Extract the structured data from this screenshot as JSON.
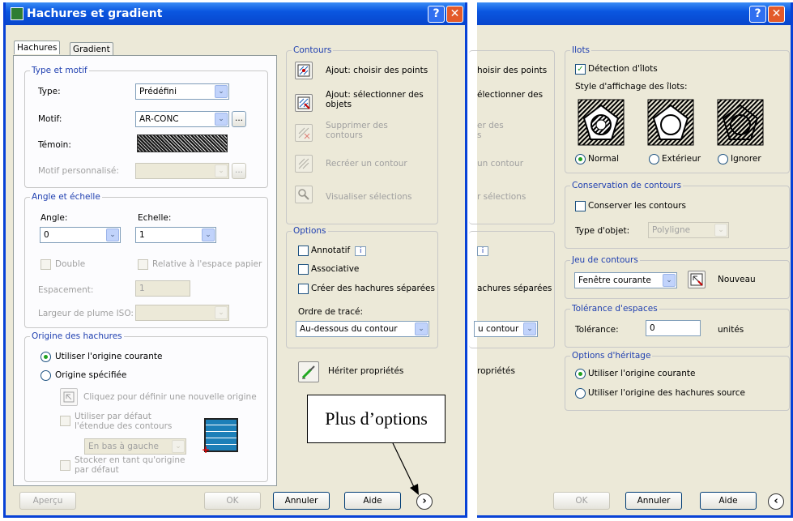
{
  "window_title": "Hachures et gradient",
  "tabs": {
    "hachures": "Hachures",
    "gradient": "Gradient"
  },
  "type_motif": {
    "title": "Type et motif",
    "type_label": "Type:",
    "type_value": "Prédéfini",
    "motif_label": "Motif:",
    "motif_value": "AR-CONC",
    "browse": "...",
    "temoin_label": "Témoin:",
    "motif_perso_label": "Motif personnalisé:"
  },
  "angle": {
    "title": "Angle et échelle",
    "angle_label": "Angle:",
    "angle_value": "0",
    "echelle_label": "Echelle:",
    "echelle_value": "1",
    "double": "Double",
    "relative": "Relative à l'espace papier",
    "espacement_label": "Espacement:",
    "espacement_value": "1",
    "largeur_label": "Largeur de plume ISO:"
  },
  "origine": {
    "title": "Origine des hachures",
    "courante": "Utiliser l'origine courante",
    "specifiee": "Origine spécifiée",
    "cliquez": "Cliquez pour définir une nouvelle origine",
    "defaut_etendue": "Utiliser par défaut l'étendue des contours",
    "position": "En bas à gauche",
    "stocker": "Stocker en tant qu'origine par défaut"
  },
  "contours": {
    "title": "Contours",
    "ajout_points": "Ajout: choisir des points",
    "ajout_objets": "Ajout: sélectionner des objets",
    "supprimer": "Supprimer des contours",
    "recreer": "Recréer un contour",
    "visualiser": "Visualiser sélections"
  },
  "options": {
    "title": "Options",
    "annotatif": "Annotatif",
    "associative": "Associative",
    "separees": "Créer des hachures séparées",
    "ordre_label": "Ordre de tracé:",
    "ordre_value": "Au-dessous du contour",
    "info": "i"
  },
  "heriter": "Hériter propriétés",
  "callout": "Plus d’options",
  "bottom": {
    "apercu": "Aperçu",
    "ok": "OK",
    "annuler": "Annuler",
    "aide": "Aide",
    "more": "›",
    "less": "‹"
  },
  "partial": {
    "points": "hoisir des points",
    "objets": "électionner des",
    "supp": "er des",
    "supp2": "s",
    "recreer": "un contour",
    "visu": "r sélections",
    "info": "i",
    "separees": "achures séparées",
    "ordre": "u contour",
    "heriter": "ropriétés"
  },
  "ilots": {
    "title": "Ilots",
    "detection": "Détection d'îlots",
    "style_label": "Style d'affichage des îlots:",
    "normal": "Normal",
    "exterieur": "Extérieur",
    "ignorer": "Ignorer"
  },
  "conservation": {
    "title": "Conservation de contours",
    "conserver": "Conserver les contours",
    "type_label": "Type d'objet:",
    "type_value": "Polyligne"
  },
  "jeu": {
    "title": "Jeu de contours",
    "value": "Fenêtre courante",
    "nouveau": "Nouveau"
  },
  "tolerance": {
    "title": "Tolérance d'espaces",
    "label": "Tolérance:",
    "value": "0",
    "unit": "unités"
  },
  "heritage": {
    "title": "Options d'héritage",
    "courante": "Utiliser l'origine courante",
    "source": "Utiliser l'origine des hachures source"
  },
  "title_buttons": {
    "help": "?",
    "close": "✕"
  },
  "check_mark": "✓",
  "combo_arrow": "⌄",
  "colors": {
    "title_blue": "#0a56e0",
    "group_title": "#1f3fb0",
    "dialog_bg": "#ece9d8"
  }
}
